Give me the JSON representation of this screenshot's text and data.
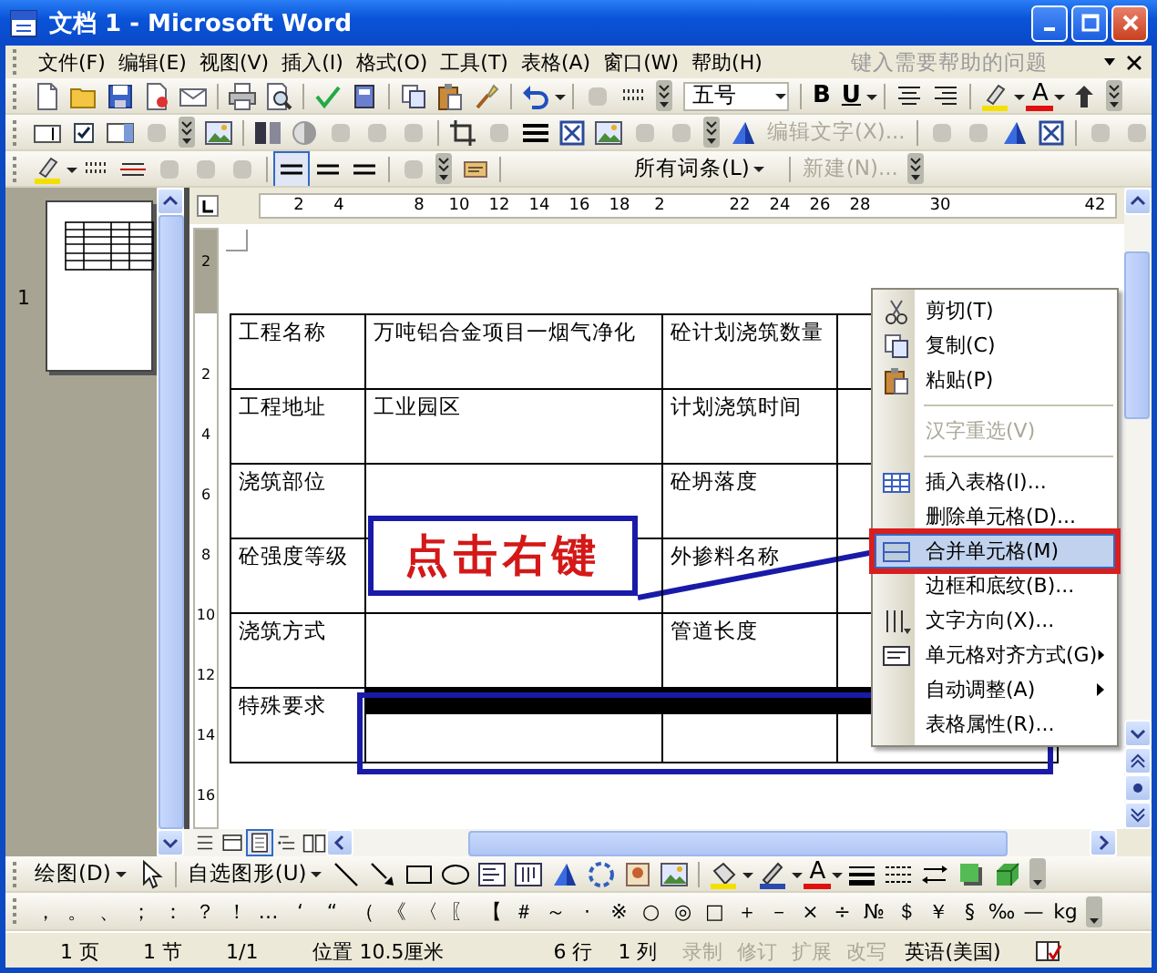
{
  "window": {
    "title": "文档 1 - Microsoft Word"
  },
  "menu_bar": [
    "文件(F)",
    "编辑(E)",
    "视图(V)",
    "插入(I)",
    "格式(O)",
    "工具(T)",
    "表格(A)",
    "窗口(W)",
    "帮助(H)"
  ],
  "help_box": {
    "placeholder": "键入需要帮助的问题"
  },
  "formatting_toolbar": {
    "font_size": "五号",
    "bold": "B",
    "underline": "U",
    "font_color": "A"
  },
  "toolbar_2": {
    "edit_text_button": {
      "label": "编辑文字(X)...",
      "disabled": true
    }
  },
  "toolbar_3": {
    "line_buttons": [
      {
        "pressed": true
      },
      {
        "pressed": false
      },
      {
        "pressed": false
      }
    ],
    "entries_dropdown": "所有词条(L)",
    "new_button": {
      "label": "新建(N)...",
      "disabled": true
    }
  },
  "thumbnails": {
    "page_label": "1"
  },
  "horizontal_ruler": [
    "2",
    "4",
    "8",
    "10",
    "12",
    "14",
    "16",
    "18",
    "2",
    "22",
    "24",
    "26",
    "28",
    "30",
    "42"
  ],
  "vertical_ruler": [
    "2",
    "2",
    "4",
    "6",
    "8",
    "10",
    "12",
    "14",
    "16"
  ],
  "table": {
    "rows": [
      {
        "cells": [
          {
            "text": "工程名称",
            "selected": false
          },
          {
            "text": "万吨铝合金项目一烟气净化",
            "selected": false
          },
          {
            "text": "砼计划浇筑数量",
            "selected": false
          },
          {
            "selected": false
          }
        ]
      },
      {
        "cells": [
          {
            "text": "工程地址",
            "selected": false
          },
          {
            "text": "工业园区",
            "selected": false
          },
          {
            "text": "计划浇筑时间",
            "selected": false
          },
          {
            "selected": false
          }
        ]
      },
      {
        "cells": [
          {
            "text": "浇筑部位",
            "selected": false
          },
          {
            "selected": false
          },
          {
            "text": "砼坍落度",
            "selected": false
          },
          {
            "selected": false
          }
        ]
      },
      {
        "cells": [
          {
            "text": "砼强度等级",
            "selected": false
          },
          {
            "selected": false
          },
          {
            "text": "外掺料名称",
            "selected": false
          },
          {
            "selected": false
          }
        ]
      },
      {
        "cells": [
          {
            "text": "浇筑方式",
            "selected": false
          },
          {
            "selected": false
          },
          {
            "text": "管道长度",
            "selected": false
          },
          {
            "selected": false
          }
        ]
      },
      {
        "cells": [
          {
            "text": "特殊要求",
            "selected": false
          },
          {
            "selected": true
          },
          {
            "selected": true
          },
          {
            "selected": true
          }
        ]
      }
    ]
  },
  "annotation": {
    "callout": "点击右键"
  },
  "context_menu": {
    "items": [
      {
        "kind": "item",
        "label": "剪切(T)",
        "disabled": false,
        "selected": false,
        "submenu": false
      },
      {
        "kind": "item",
        "label": "复制(C)",
        "disabled": false,
        "selected": false,
        "submenu": false
      },
      {
        "kind": "item",
        "label": "粘贴(P)",
        "disabled": false,
        "selected": false,
        "submenu": false
      },
      {
        "kind": "divider"
      },
      {
        "kind": "item",
        "label": "汉字重选(V)",
        "disabled": true,
        "selected": false,
        "submenu": false
      },
      {
        "kind": "divider"
      },
      {
        "kind": "item",
        "label": "插入表格(I)...",
        "disabled": false,
        "selected": false,
        "submenu": false
      },
      {
        "kind": "item",
        "label": "删除单元格(D)...",
        "disabled": false,
        "selected": false,
        "submenu": false
      },
      {
        "kind": "item",
        "label": "合并单元格(M)",
        "disabled": false,
        "selected": true,
        "submenu": false
      },
      {
        "kind": "item",
        "label": "边框和底纹(B)...",
        "disabled": false,
        "selected": false,
        "submenu": false
      },
      {
        "kind": "item",
        "label": "文字方向(X)...",
        "disabled": false,
        "selected": false,
        "submenu": false
      },
      {
        "kind": "item",
        "label": "单元格对齐方式(G)",
        "disabled": false,
        "selected": false,
        "submenu": true
      },
      {
        "kind": "item",
        "label": "自动调整(A)",
        "disabled": false,
        "selected": false,
        "submenu": true
      },
      {
        "kind": "item",
        "label": "表格属性(R)...",
        "disabled": false,
        "selected": false,
        "submenu": false
      }
    ]
  },
  "drawing_toolbar": {
    "draw_menu": "绘图(D)",
    "autoshapes_menu": "自选图形(U)",
    "font_color": "A"
  },
  "symbols": [
    "，",
    "。",
    "、",
    "；",
    "：",
    "？",
    "！",
    "…",
    "‘",
    "“",
    "（",
    "《",
    "〈",
    "〖",
    "【",
    "＃",
    "～",
    "·",
    "※",
    "○",
    "◎",
    "□",
    "＋",
    "－",
    "×",
    "÷",
    "№",
    "＄",
    "￥",
    "§",
    "‰",
    "—",
    "kg"
  ],
  "status_bar": [
    {
      "text": "1 页",
      "disabled": false
    },
    {
      "text": "1 节",
      "disabled": false
    },
    {
      "text": "1/1",
      "disabled": false
    },
    {
      "text": "位置 10.5厘米",
      "disabled": false
    },
    {
      "text": "6 行",
      "disabled": false
    },
    {
      "text": "1 列",
      "disabled": false
    },
    {
      "text": "录制",
      "disabled": true
    },
    {
      "text": "修订",
      "disabled": true
    },
    {
      "text": "扩展",
      "disabled": true
    },
    {
      "text": "改写",
      "disabled": true
    },
    {
      "text": "英语(美国)",
      "disabled": false
    }
  ]
}
